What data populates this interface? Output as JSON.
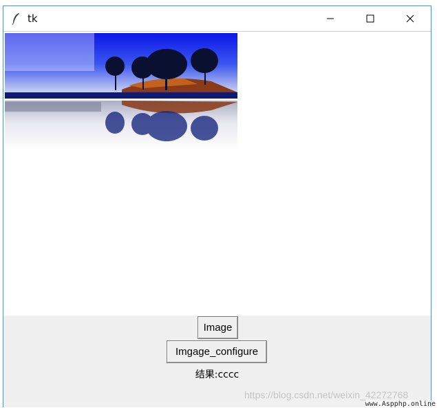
{
  "window": {
    "title": "tk",
    "controls": {
      "minimize": "minimize-icon",
      "maximize": "maximize-icon",
      "close": "close-icon"
    }
  },
  "image": {
    "alt": "snowy lakeside trees reflected in water"
  },
  "buttons": {
    "image_label": "Image",
    "configure_label": "Imgage_configure"
  },
  "result_text": "结果:cccc",
  "watermark": "https://blog.csdn.net/weixin_42272768",
  "site_badge": "www.Aspphp.online",
  "colors": {
    "window_border": "#5a8fc4",
    "panel_bg": "#f0f0f0"
  }
}
